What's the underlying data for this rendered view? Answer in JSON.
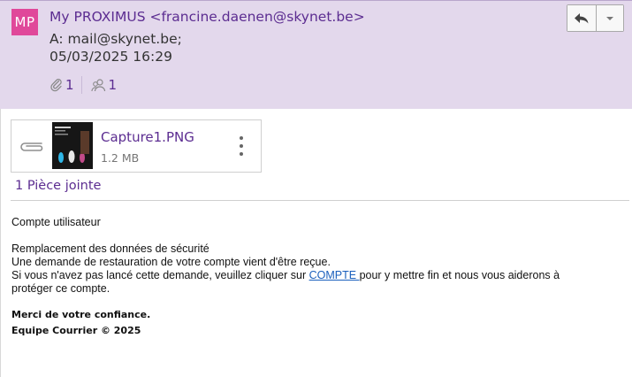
{
  "header": {
    "avatar_initials": "MP",
    "from": "My PROXIMUS <francine.daenen@skynet.be>",
    "to": "A: mail@skynet.be;",
    "date": "05/03/2025 16:29",
    "attachment_count": "1",
    "recipient_count": "1",
    "colors": {
      "header_bg": "#e3d8ec",
      "accent": "#5c2d91",
      "avatar_bg": "#e0489a"
    }
  },
  "toolbar": {
    "reply_icon": "reply-icon",
    "more_icon": "chevron-down-icon"
  },
  "attachment": {
    "name": "Capture1.PNG",
    "size": "1.2 MB",
    "summary": "1 Pièce jointe"
  },
  "message": {
    "line1": "Compte utilisateur",
    "line2": "Remplacement des données de sécurité",
    "line3": "Une demande de restauration de votre compte vient d'être reçue.",
    "line4_pre": "Si vous n'avez pas lancé cette demande, veuillez cliquer sur ",
    "link_text": "COMPTE ",
    "line4_post": "pour y mettre fin et nous vous aiderons à",
    "line5": "protéger ce compte.",
    "sig1": "Merci de votre confiance.",
    "sig2": "Equipe Courrier © 2025"
  }
}
